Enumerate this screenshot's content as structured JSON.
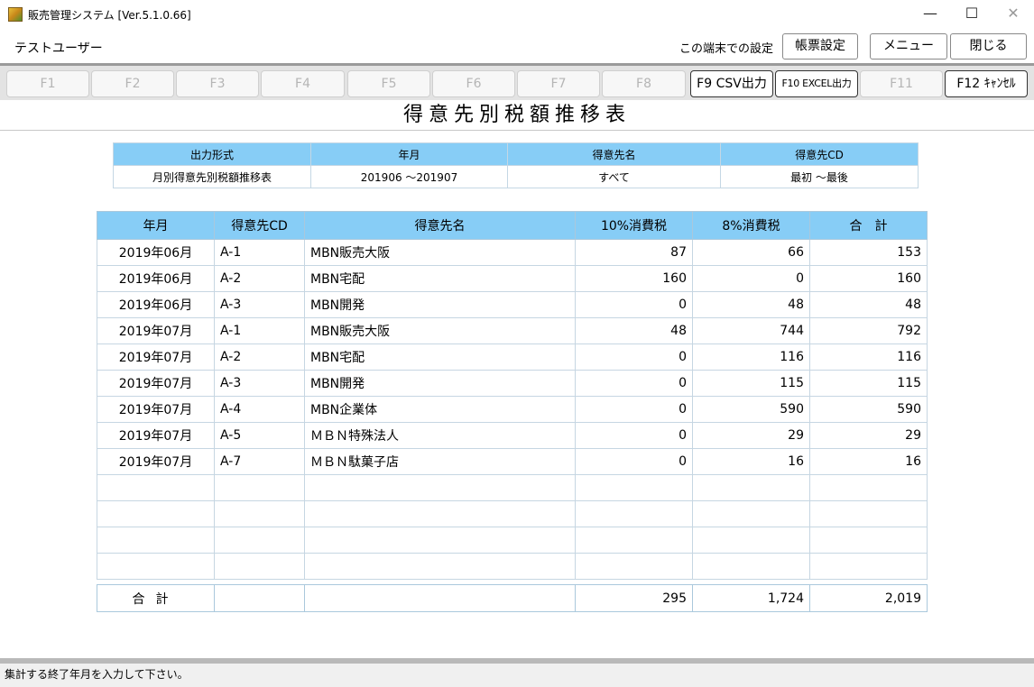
{
  "window": {
    "title": "販売管理システム [Ver.5.1.0.66]",
    "minimize": "—",
    "maximize": "☐",
    "close": "✕"
  },
  "header": {
    "user": "テストユーザー",
    "terminal_label": "この端末での設定",
    "buttons": [
      "帳票設定",
      "メニュー",
      "閉じる"
    ]
  },
  "fkeys": [
    {
      "label": "F1",
      "enabled": false
    },
    {
      "label": "F2",
      "enabled": false
    },
    {
      "label": "F3",
      "enabled": false
    },
    {
      "label": "F4",
      "enabled": false
    },
    {
      "label": "F5",
      "enabled": false
    },
    {
      "label": "F6",
      "enabled": false
    },
    {
      "label": "F7",
      "enabled": false
    },
    {
      "label": "F8",
      "enabled": false
    },
    {
      "label": "F9 CSV出力",
      "enabled": true
    },
    {
      "label": "F10 EXCEL出力",
      "enabled": true
    },
    {
      "label": "F11",
      "enabled": false
    },
    {
      "label": "F12 ｷｬﾝｾﾙ",
      "enabled": true
    }
  ],
  "report_title": "得意先別税額推移表",
  "conditions": {
    "headers": [
      "出力形式",
      "年月",
      "得意先名",
      "得意先CD"
    ],
    "values": [
      "月別得意先別税額推移表",
      "201906 ～201907",
      "すべて",
      "最初 ～最後"
    ]
  },
  "table": {
    "headers": [
      "年月",
      "得意先CD",
      "得意先名",
      "10%消費税",
      "8%消費税",
      "合　計"
    ],
    "rows": [
      [
        "2019年06月",
        "A-1",
        "MBN販売大阪",
        "87",
        "66",
        "153"
      ],
      [
        "2019年06月",
        "A-2",
        "MBN宅配",
        "160",
        "0",
        "160"
      ],
      [
        "2019年06月",
        "A-3",
        "MBN開発",
        "0",
        "48",
        "48"
      ],
      [
        "2019年07月",
        "A-1",
        "MBN販売大阪",
        "48",
        "744",
        "792"
      ],
      [
        "2019年07月",
        "A-2",
        "MBN宅配",
        "0",
        "116",
        "116"
      ],
      [
        "2019年07月",
        "A-3",
        "MBN開発",
        "0",
        "115",
        "115"
      ],
      [
        "2019年07月",
        "A-4",
        "MBN企業体",
        "0",
        "590",
        "590"
      ],
      [
        "2019年07月",
        "A-5",
        "ＭＢＮ特殊法人",
        "0",
        "29",
        "29"
      ],
      [
        "2019年07月",
        "A-7",
        "ＭＢＮ駄菓子店",
        "0",
        "16",
        "16"
      ],
      [
        "",
        "",
        "",
        "",
        "",
        ""
      ],
      [
        "",
        "",
        "",
        "",
        "",
        ""
      ],
      [
        "",
        "",
        "",
        "",
        "",
        ""
      ],
      [
        "",
        "",
        "",
        "",
        "",
        ""
      ]
    ]
  },
  "totals": {
    "label": "合計",
    "tax10": "295",
    "tax8": "1,724",
    "total": "2,019"
  },
  "status": "集計する終了年月を入力して下さい。"
}
